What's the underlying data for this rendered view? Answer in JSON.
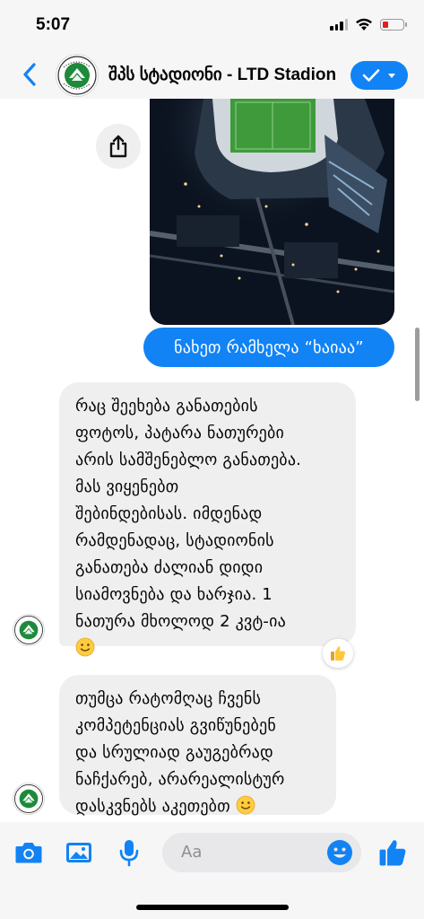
{
  "status_bar": {
    "time": "5:07",
    "icons": [
      "signal-icon",
      "wifi-icon",
      "battery-icon"
    ],
    "battery_color": "#e02020"
  },
  "header": {
    "title": "შპს სტადიონი - LTD Stadion",
    "back_icon": "chevron-left-icon",
    "avatar_text": "STADION",
    "verify_icon": "checkmark-icon",
    "accent": "#1183f5"
  },
  "chat": {
    "outgoing_message": "ნახეთ რამხელა “ხაიაა”",
    "incoming_messages": [
      {
        "text": "რაც შეეხება განათების\nფოტოს, პატარა ნათურები\nარის სამშენებლო განათება.\nმას ვიყენებთ\nშებინდებისას. იმდენად\nრამდენადაც, სტადიონის\nგანათება ძალიან დიდი\nსიამოვნება და ხარჯია. 1\nნათურა მხოლოდ 2 კვტ-ია",
        "emoji": "slightly-smiling-face",
        "reaction": "thumbs-up"
      },
      {
        "text": "თუმცა რატომღაც ჩვენს\nკომპეტენციას გვიწუნებენ\nდა სრულიად გაუგებრად\nნაჩქარებ, არარეალისტურ\nდასკვნებს აკეთებთ",
        "emoji": "slightly-smiling-face"
      }
    ],
    "share_icon": "share-icon",
    "incoming_bubble_color": "#efefef",
    "outgoing_bubble_color": "#1183f5"
  },
  "composer": {
    "placeholder": "Aa",
    "icons": [
      "camera-icon",
      "gallery-icon",
      "microphone-icon",
      "emoji-icon",
      "thumbs-up-icon"
    ]
  }
}
